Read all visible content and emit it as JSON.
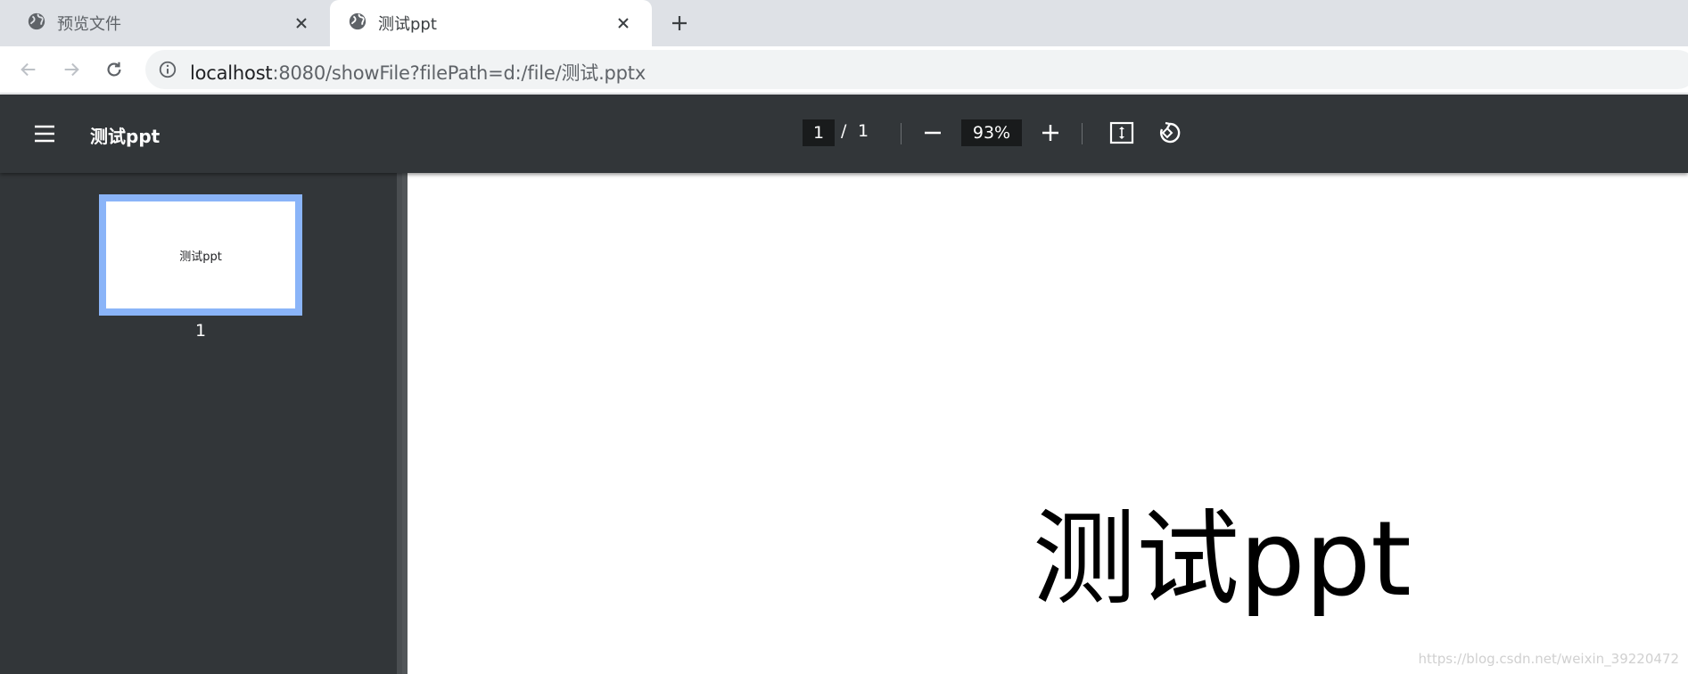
{
  "browser": {
    "tabs": [
      {
        "title": "预览文件",
        "icon": "globe-icon",
        "active": false
      },
      {
        "title": "测试ppt",
        "icon": "globe-icon",
        "active": true
      }
    ],
    "address": {
      "host": "localhost",
      "rest": ":8080/showFile?filePath=d:/file/测试.pptx"
    }
  },
  "pdf_viewer": {
    "title": "测试ppt",
    "page_current": "1",
    "page_separator": "/",
    "page_total": "1",
    "zoom": "93%",
    "thumbnail_text": "测试ppt",
    "thumbnail_label": "1",
    "slide_title": "测试ppt",
    "accent_color": "#8ab4f8",
    "toolbar_color": "#323639"
  },
  "watermark": "https://blog.csdn.net/weixin_39220472"
}
